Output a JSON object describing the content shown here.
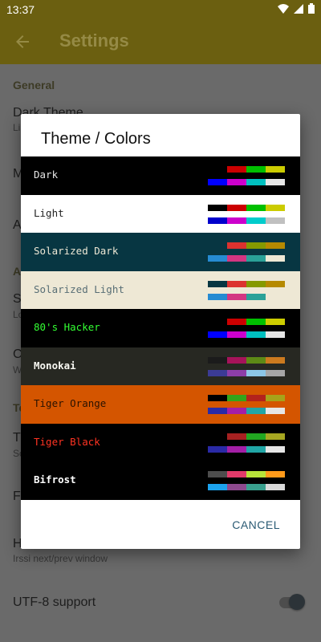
{
  "status_bar": {
    "time": "13:37"
  },
  "toolbar": {
    "title": "Settings"
  },
  "settings": {
    "general_header": "General",
    "dark_theme_title": "Dark Theme",
    "dark_theme_sub": "Li",
    "m_title": "M",
    "a_title": "A",
    "a_header": "A",
    "s_title": "S",
    "s_sub": "Lo",
    "c_title": "C",
    "c_sub": "W",
    "t_header": "Te",
    "t_title": "T",
    "t_sub": "Sc",
    "f_title": "Fo",
    "h_title": "H",
    "h_sub": "Irssi next/prev window",
    "utf8_title": "UTF-8 support"
  },
  "dialog": {
    "title": "Theme / Colors",
    "cancel": "CANCEL",
    "themes": [
      {
        "name": "Dark",
        "bg": "#000000",
        "fg": "#e6e6e6",
        "bold": false,
        "top": [
          "#000000",
          "#cc0000",
          "#00c000",
          "#cccc00"
        ],
        "bottom": [
          "#0000ff",
          "#cc00cc",
          "#00c0c0",
          "#e6e6e6"
        ]
      },
      {
        "name": "Light",
        "bg": "#ffffff",
        "fg": "#222222",
        "bold": false,
        "top": [
          "#000000",
          "#cc0000",
          "#00c000",
          "#cccc00"
        ],
        "bottom": [
          "#0000cc",
          "#cc00cc",
          "#00cccc",
          "#c0c0c0"
        ]
      },
      {
        "name": "Solarized Dark",
        "bg": "#073642",
        "fg": "#eee8d5",
        "bold": false,
        "top": [
          "#073642",
          "#dc322f",
          "#859900",
          "#b58900"
        ],
        "bottom": [
          "#268bd2",
          "#d33682",
          "#2aa198",
          "#eee8d5"
        ]
      },
      {
        "name": "Solarized Light",
        "bg": "#eee8d5",
        "fg": "#586e75",
        "bold": false,
        "top": [
          "#073642",
          "#dc322f",
          "#859900",
          "#b58900"
        ],
        "bottom": [
          "#268bd2",
          "#d33682",
          "#2aa198",
          "#eee8d5"
        ]
      },
      {
        "name": "80's Hacker",
        "bg": "#000000",
        "fg": "#33ff33",
        "bold": false,
        "top": [
          "#000000",
          "#cc0000",
          "#00c000",
          "#cccc00"
        ],
        "bottom": [
          "#0000ff",
          "#cc00cc",
          "#00c0c0",
          "#e6e6e6"
        ]
      },
      {
        "name": "Monokai",
        "bg": "#272822",
        "fg": "#f8f8f2",
        "bold": true,
        "top": [
          "#1b1b1b",
          "#a6135a",
          "#5d8a16",
          "#cc7a1f"
        ],
        "bottom": [
          "#3b3b95",
          "#8c3ea8",
          "#8cc6e6",
          "#a6a6a6"
        ]
      },
      {
        "name": "Tiger Orange",
        "bg": "#d45500",
        "fg": "#2a1200",
        "bold": false,
        "top": [
          "#000000",
          "#33a51a",
          "#b3221c",
          "#a6a31a"
        ],
        "bottom": [
          "#2a2aa6",
          "#a41fa6",
          "#21a6a6",
          "#e6e6e6"
        ]
      },
      {
        "name": "Tiger Black",
        "bg": "#000000",
        "fg": "#ff3322",
        "bold": false,
        "top": [
          "#000000",
          "#a62121",
          "#21a621",
          "#a6a621"
        ],
        "bottom": [
          "#2a2aa6",
          "#a41fa6",
          "#21a6a6",
          "#e6e6e6"
        ]
      },
      {
        "name": "Bifrost",
        "bg": "#000000",
        "fg": "#ffffff",
        "bold": true,
        "top": [
          "#4d4d4d",
          "#e23a6a",
          "#b7e33a",
          "#ff9a1a"
        ],
        "bottom": [
          "#1ca3ee",
          "#8e4a8e",
          "#39a08e",
          "#d9d9d9"
        ]
      }
    ]
  }
}
